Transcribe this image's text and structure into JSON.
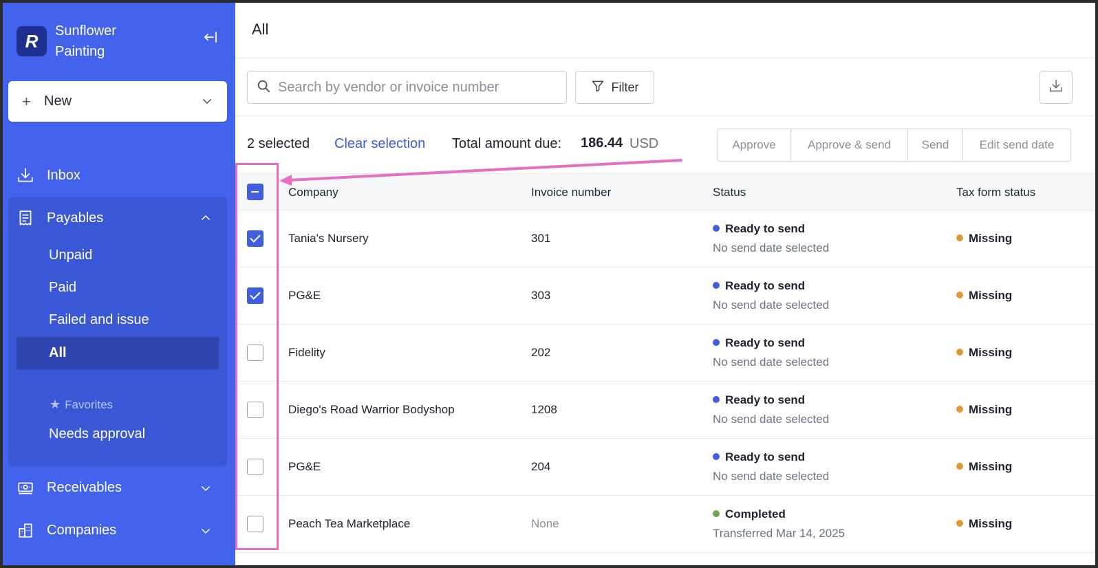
{
  "sidebar": {
    "logo_letter": "R",
    "company_name": "Sunflower Painting",
    "new_button_label": "New",
    "inbox_label": "Inbox",
    "payables_label": "Payables",
    "payables_sub": [
      "Unpaid",
      "Paid",
      "Failed and issue",
      "All"
    ],
    "active_sub": "All",
    "favorites_label": "Favorites",
    "favorites_items": [
      "Needs approval"
    ],
    "receivables_label": "Receivables",
    "companies_label": "Companies"
  },
  "main": {
    "title": "All",
    "search_placeholder": "Search by vendor or invoice number",
    "filter_label": "Filter",
    "selection": {
      "count_text": "2 selected",
      "clear_label": "Clear selection",
      "total_label": "Total amount due:",
      "total_value": "186.44",
      "currency": "USD"
    },
    "actions": [
      "Approve",
      "Approve & send",
      "Send",
      "Edit send date"
    ],
    "table": {
      "columns": [
        "Company",
        "Invoice number",
        "Status",
        "Tax form status"
      ],
      "rows": [
        {
          "checked": true,
          "company": "Tania's Nursery",
          "invoice": "301",
          "status": "Ready to send",
          "status_sub": "No send date selected",
          "status_color": "#3f5fe0",
          "tax": "Missing",
          "tax_color": "#e0992f"
        },
        {
          "checked": true,
          "company": "PG&E",
          "invoice": "303",
          "status": "Ready to send",
          "status_sub": "No send date selected",
          "status_color": "#3f5fe0",
          "tax": "Missing",
          "tax_color": "#e0992f"
        },
        {
          "checked": false,
          "company": "Fidelity",
          "invoice": "202",
          "status": "Ready to send",
          "status_sub": "No send date selected",
          "status_color": "#3f5fe0",
          "tax": "Missing",
          "tax_color": "#e0992f"
        },
        {
          "checked": false,
          "company": "Diego's Road Warrior Bodyshop",
          "invoice": "1208",
          "status": "Ready to send",
          "status_sub": "No send date selected",
          "status_color": "#3f5fe0",
          "tax": "Missing",
          "tax_color": "#e0992f"
        },
        {
          "checked": false,
          "company": "PG&E",
          "invoice": "204",
          "status": "Ready to send",
          "status_sub": "No send date selected",
          "status_color": "#3f5fe0",
          "tax": "Missing",
          "tax_color": "#e0992f"
        },
        {
          "checked": false,
          "company": "Peach Tea Marketplace",
          "invoice": "None",
          "status": "Completed",
          "status_sub": "Transferred Mar 14, 2025",
          "status_color": "#6aa84f",
          "tax": "Missing",
          "tax_color": "#e0992f"
        }
      ]
    }
  },
  "colors": {
    "sidebar_bg": "#4363ec",
    "accent": "#3f5fe0",
    "annotation": "#e66fc2"
  },
  "icons": [
    "collapse-sidebar-icon",
    "plus-icon",
    "chevron-down-icon",
    "inbox-download-icon",
    "receipt-icon",
    "chevron-up-icon",
    "star-icon",
    "receivables-icon",
    "buildings-icon",
    "search-icon",
    "filter-icon",
    "download-icon"
  ]
}
